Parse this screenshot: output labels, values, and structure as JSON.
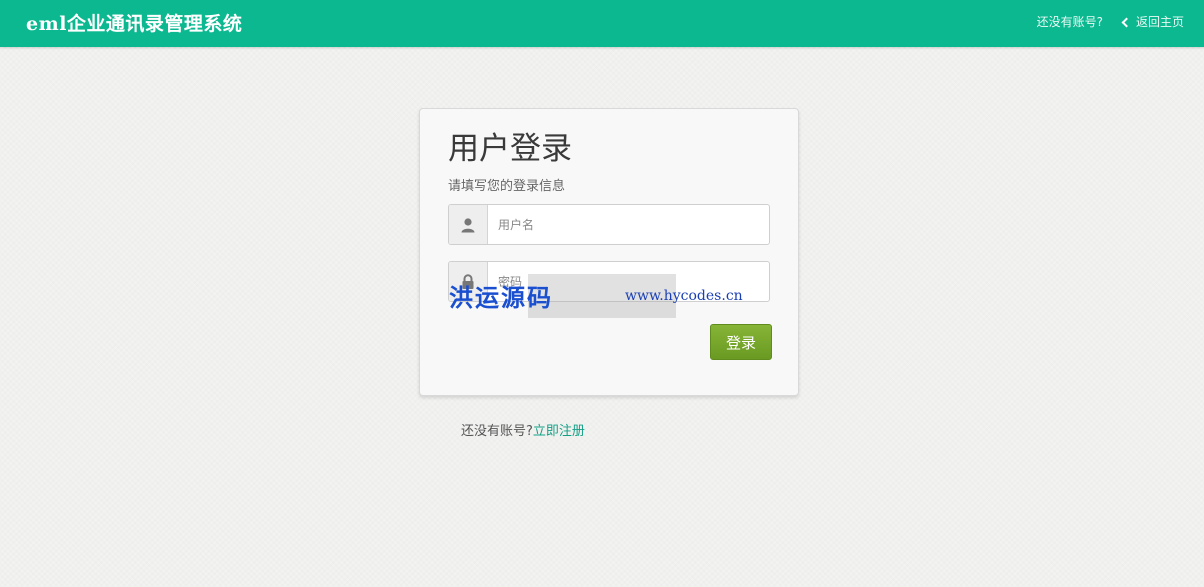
{
  "header": {
    "brand": "eml企业通讯录管理系统",
    "no_account": "还没有账号?",
    "back_home": "返回主页"
  },
  "login": {
    "title": "用户登录",
    "subtitle": "请填写您的登录信息",
    "username_placeholder": "用户名",
    "password_placeholder": "密码",
    "submit_label": "登录"
  },
  "watermark": {
    "text": "洪运源码",
    "url": "www.hycodes.cn"
  },
  "footer": {
    "prompt": "还没有账号?",
    "register_link": "立即注册"
  },
  "colors": {
    "header_bg": "#0cb890",
    "button_bg": "#76a82b",
    "link": "#12a085"
  },
  "icons": {
    "user": "user-icon",
    "password": "lock-icon",
    "back": "chevron-left-icon"
  }
}
